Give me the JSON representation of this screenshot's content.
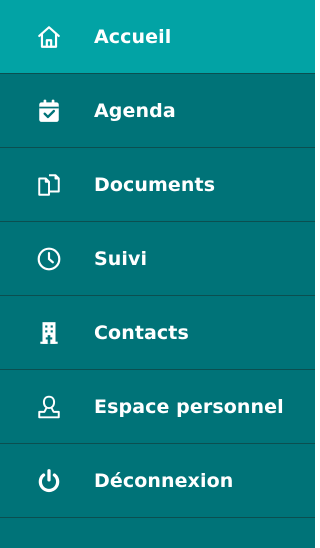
{
  "nav": {
    "items": [
      {
        "label": "Accueil",
        "icon": "home-icon",
        "active": true
      },
      {
        "label": "Agenda",
        "icon": "calendar-check-icon",
        "active": false
      },
      {
        "label": "Documents",
        "icon": "documents-icon",
        "active": false
      },
      {
        "label": "Suivi",
        "icon": "clock-icon",
        "active": false
      },
      {
        "label": "Contacts",
        "icon": "building-icon",
        "active": false
      },
      {
        "label": "Espace personnel",
        "icon": "user-icon",
        "active": false
      },
      {
        "label": "Déconnexion",
        "icon": "power-icon",
        "active": false
      }
    ]
  },
  "colors": {
    "sidebar_background": "#007378",
    "active_background": "#02a3a5",
    "divider": "#0b4f50",
    "text": "#ffffff"
  }
}
